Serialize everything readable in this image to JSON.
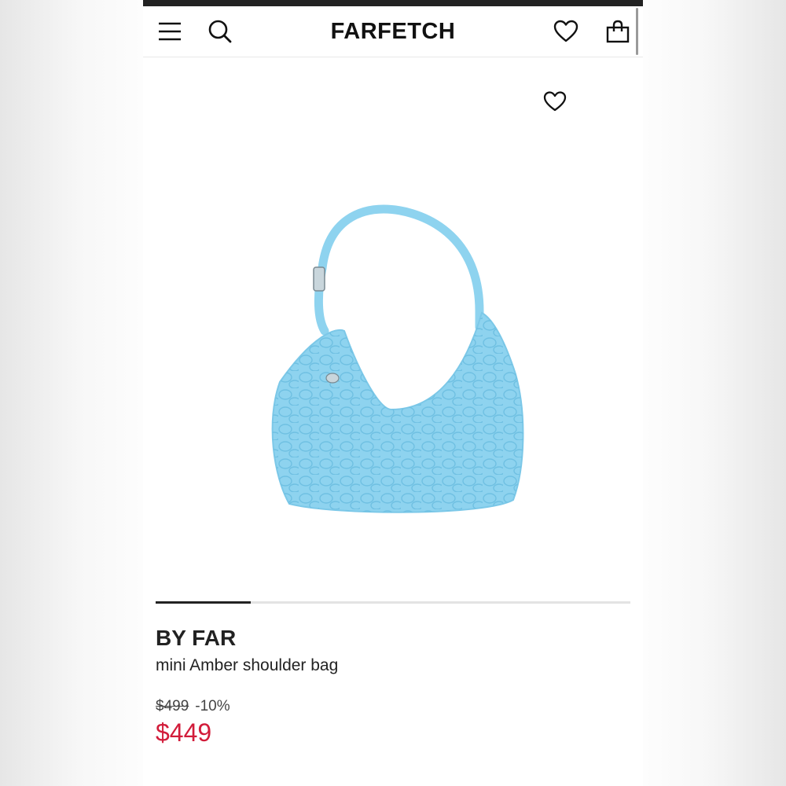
{
  "header": {
    "logo": "FARFETCH",
    "icons": [
      "menu-icon",
      "search-icon",
      "heart-icon",
      "shopping-bag-icon"
    ]
  },
  "product": {
    "brand": "BY FAR",
    "name": "mini Amber shoulder bag",
    "original_price": "$499",
    "discount": "-10%",
    "price": "$449",
    "image_color": "#8ed3ef",
    "carousel_progress": 0.2
  },
  "colors": {
    "accent_price": "#d21c3a",
    "text": "#222222"
  }
}
